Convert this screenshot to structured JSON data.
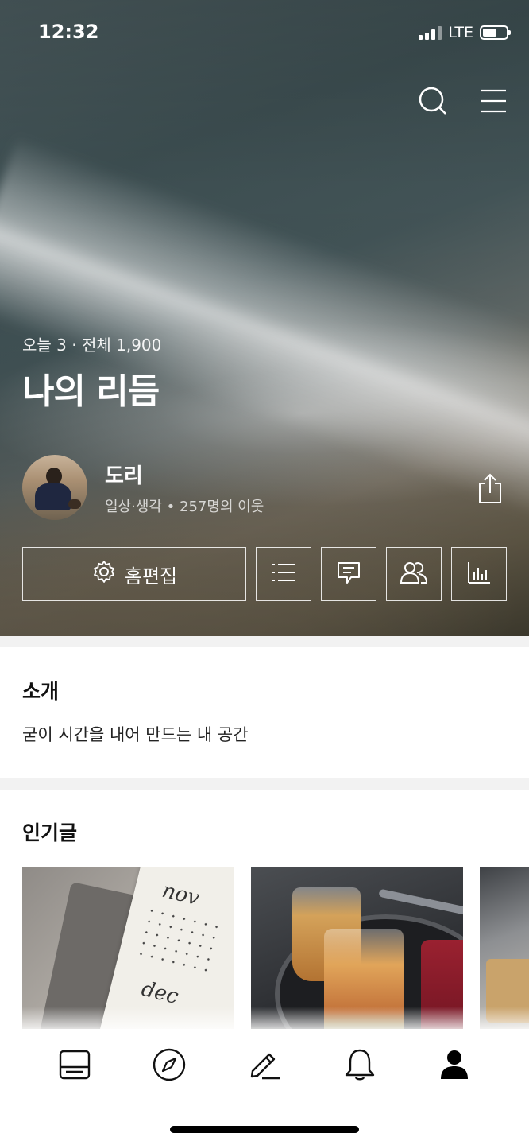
{
  "status_bar": {
    "time": "12:32",
    "network": "LTE",
    "battery_level": 0.6
  },
  "header": {
    "icons": [
      "search-icon",
      "menu-icon"
    ]
  },
  "blog": {
    "stats": "오늘 3 · 전체 1,900",
    "title": "나의 리듬",
    "owner_name": "도리",
    "owner_meta": "일상·생각 • 257명의 이웃"
  },
  "actions": {
    "edit_label": "홈편집",
    "icons": [
      "list-icon",
      "comment-icon",
      "neighbors-icon",
      "stats-chart-icon"
    ]
  },
  "intro": {
    "title": "소개",
    "text": "굳이 시간을 내어 만드는 내 공간"
  },
  "popular": {
    "title": "인기글",
    "thumb_texts": [
      "nov",
      "dec"
    ]
  },
  "tabbar": {
    "items": [
      "feed-icon",
      "compass-icon",
      "write-icon",
      "bell-icon",
      "profile-icon"
    ],
    "active": "profile-icon"
  },
  "colors": {
    "accent": "#000000",
    "hero_text": "#ffffff"
  }
}
